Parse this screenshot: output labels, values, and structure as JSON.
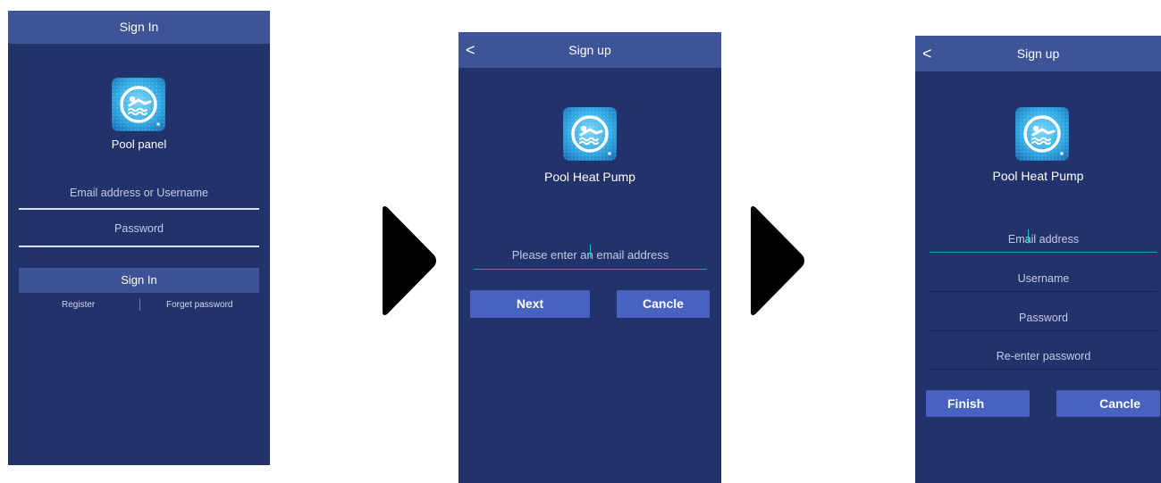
{
  "screen1": {
    "title": "Sign In",
    "app_name": "Pool panel",
    "email_placeholder": "Email address or Username",
    "password_placeholder": "Password",
    "sign_in_label": "Sign In",
    "register_label": "Register",
    "forget_label": "Forget password"
  },
  "screen2": {
    "back": "<",
    "title": "Sign up",
    "app_name": "Pool Heat Pump",
    "email_prompt": "Please enter an email address",
    "next_label": "Next",
    "cancel_label": "Cancle"
  },
  "screen3": {
    "back": "<",
    "title": "Sign up",
    "app_name": "Pool Heat Pump",
    "email_placeholder": "Email address",
    "username_placeholder": "Username",
    "password_placeholder": "Password",
    "reenter_placeholder": "Re-enter password",
    "finish_label": "Finish",
    "cancel_label": "Cancle"
  },
  "icons": {
    "app_logo": "swimmer-icon",
    "flow_arrow": "play-arrow-icon",
    "back": "chevron-left-icon"
  },
  "colors": {
    "background": "#22336b",
    "titlebar": "#3d5497",
    "button": "#4762c0",
    "accent": "#1fa39a"
  }
}
